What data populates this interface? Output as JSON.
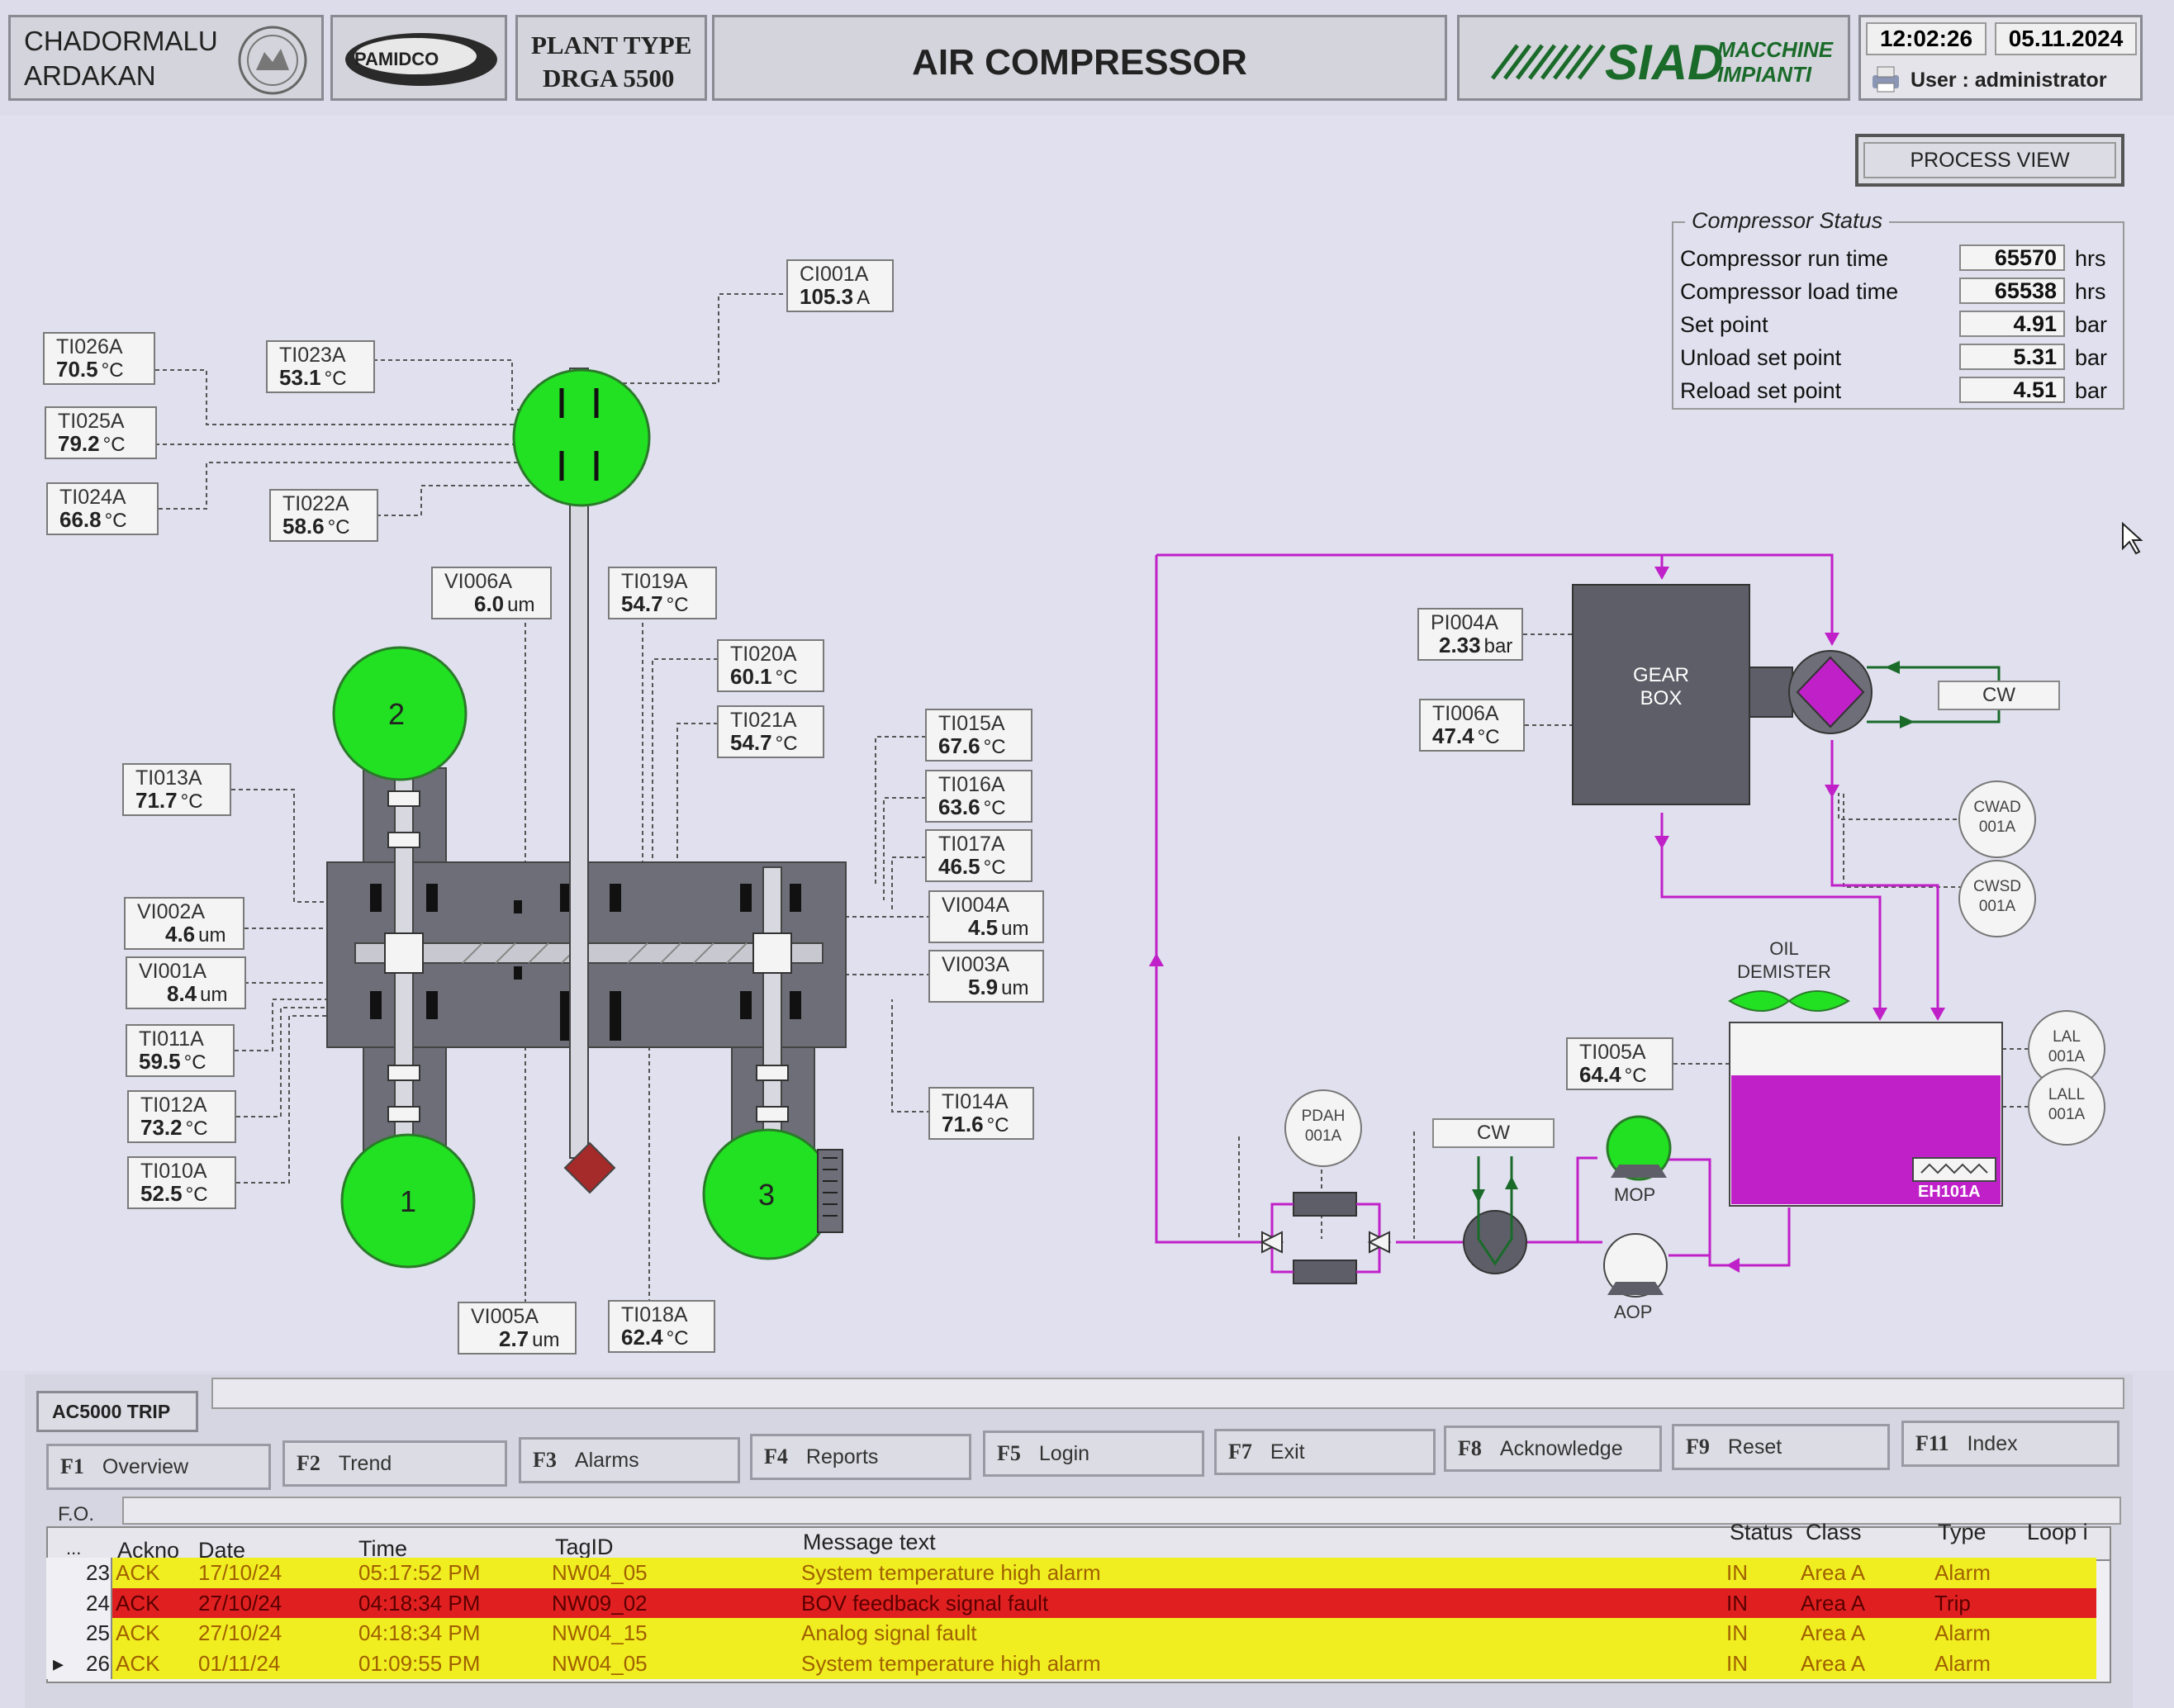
{
  "header": {
    "company_line1": "CHADORMALU",
    "company_line2": "ARDAKAN",
    "brand_logo_text": "PAMIDCO",
    "plant_type_label": "PLANT TYPE",
    "plant_type_value": "DRGA 5500",
    "title": "AIR COMPRESSOR",
    "vendor_logo_main": "SIAD",
    "vendor_logo_sub1": "MACCHINE",
    "vendor_logo_sub2": "IMPIANTI",
    "time": "12:02:26",
    "date": "05.11.2024",
    "user": "User : administrator"
  },
  "process_view_button": "PROCESS VIEW",
  "compressor_status": {
    "title": "Compressor Status",
    "rows": [
      {
        "label": "Compressor run time",
        "value": "65570",
        "unit": "hrs"
      },
      {
        "label": "Compressor load time",
        "value": "65538",
        "unit": "hrs"
      },
      {
        "label": "Set point",
        "value": "4.91",
        "unit": "bar"
      },
      {
        "label": "Unload set point",
        "value": "5.31",
        "unit": "bar"
      },
      {
        "label": "Reload set point",
        "value": "4.51",
        "unit": "bar"
      }
    ]
  },
  "tags": {
    "CI001A": {
      "id": "CI001A",
      "value": "105.3",
      "unit": "A"
    },
    "TI026A": {
      "id": "TI026A",
      "value": "70.5",
      "unit": "°C"
    },
    "TI023A": {
      "id": "TI023A",
      "value": "53.1",
      "unit": "°C"
    },
    "TI025A": {
      "id": "TI025A",
      "value": "79.2",
      "unit": "°C"
    },
    "TI024A": {
      "id": "TI024A",
      "value": "66.8",
      "unit": "°C"
    },
    "TI022A": {
      "id": "TI022A",
      "value": "58.6",
      "unit": "°C"
    },
    "VI006A": {
      "id": "VI006A",
      "value": "6.0",
      "unit": "um"
    },
    "TI019A": {
      "id": "TI019A",
      "value": "54.7",
      "unit": "°C"
    },
    "TI020A": {
      "id": "TI020A",
      "value": "60.1",
      "unit": "°C"
    },
    "TI021A": {
      "id": "TI021A",
      "value": "54.7",
      "unit": "°C"
    },
    "TI015A": {
      "id": "TI015A",
      "value": "67.6",
      "unit": "°C"
    },
    "TI016A": {
      "id": "TI016A",
      "value": "63.6",
      "unit": "°C"
    },
    "TI017A": {
      "id": "TI017A",
      "value": "46.5",
      "unit": "°C"
    },
    "VI004A": {
      "id": "VI004A",
      "value": "4.5",
      "unit": "um"
    },
    "VI003A": {
      "id": "VI003A",
      "value": "5.9",
      "unit": "um"
    },
    "TI014A": {
      "id": "TI014A",
      "value": "71.6",
      "unit": "°C"
    },
    "TI013A": {
      "id": "TI013A",
      "value": "71.7",
      "unit": "°C"
    },
    "VI002A": {
      "id": "VI002A",
      "value": "4.6",
      "unit": "um"
    },
    "VI001A": {
      "id": "VI001A",
      "value": "8.4",
      "unit": "um"
    },
    "TI011A": {
      "id": "TI011A",
      "value": "59.5",
      "unit": "°C"
    },
    "TI012A": {
      "id": "TI012A",
      "value": "73.2",
      "unit": "°C"
    },
    "TI010A": {
      "id": "TI010A",
      "value": "52.5",
      "unit": "°C"
    },
    "VI005A": {
      "id": "VI005A",
      "value": "2.7",
      "unit": "um"
    },
    "TI018A": {
      "id": "TI018A",
      "value": "62.4",
      "unit": "°C"
    },
    "PI004A": {
      "id": "PI004A",
      "value": "2.33",
      "unit": "bar"
    },
    "TI006A": {
      "id": "TI006A",
      "value": "47.4",
      "unit": "°C"
    },
    "TI005A": {
      "id": "TI005A",
      "value": "64.4",
      "unit": "°C"
    }
  },
  "stages": {
    "s1": "1",
    "s2": "2",
    "s3": "3"
  },
  "oil_system": {
    "gearbox_line1": "GEAR",
    "gearbox_line2": "BOX",
    "cw_cooler": "CW",
    "cw_pump": "CW",
    "cwad": [
      "CWAD",
      "001A"
    ],
    "cwsd": [
      "CWSD",
      "001A"
    ],
    "demister_line1": "OIL",
    "demister_line2": "DEMISTER",
    "tank_heater": "EH101A",
    "lal": [
      "LAL",
      "001A"
    ],
    "lall": [
      "LALL",
      "001A"
    ],
    "pdah": [
      "PDAH",
      "001A"
    ],
    "mop": "MOP",
    "aop": "AOP"
  },
  "colors": {
    "running_green": "#22e022",
    "oil_magenta": "#c020c8",
    "alarm_yellow": "#f0ee20",
    "trip_red": "#e02020"
  },
  "trip_label": "AC5000 TRIP",
  "function_keys": [
    {
      "key": "F1",
      "label": "Overview"
    },
    {
      "key": "F2",
      "label": "Trend"
    },
    {
      "key": "F3",
      "label": "Alarms"
    },
    {
      "key": "F4",
      "label": "Reports"
    },
    {
      "key": "F5",
      "label": "Login"
    },
    {
      "key": "F7",
      "label": "Exit"
    },
    {
      "key": "F8",
      "label": "Acknowledge"
    },
    {
      "key": "F9",
      "label": "Reset"
    },
    {
      "key": "F11",
      "label": "Index"
    }
  ],
  "fo_label": "F.O.",
  "alarm_table": {
    "columns": [
      "...",
      "Ackno",
      "Date",
      "Time",
      "TagID",
      "Message text",
      "Status",
      "Class",
      "Type",
      "Loop i"
    ],
    "rows": [
      {
        "num": "23",
        "ack": "ACK",
        "date": "17/10/24",
        "time": "05:17:52 PM",
        "tag": "NW04_05",
        "msg": "System temperature high alarm",
        "status": "IN",
        "class": "Area A",
        "type": "Alarm",
        "color": "#f0ee20"
      },
      {
        "num": "24",
        "ack": "ACK",
        "date": "27/10/24",
        "time": "04:18:34 PM",
        "tag": "NW09_02",
        "msg": "BOV feedback signal fault",
        "status": "IN",
        "class": "Area A",
        "type": "Trip",
        "color": "#e02020"
      },
      {
        "num": "25",
        "ack": "ACK",
        "date": "27/10/24",
        "time": "04:18:34 PM",
        "tag": "NW04_15",
        "msg": "Analog signal fault",
        "status": "IN",
        "class": "Area A",
        "type": "Alarm",
        "color": "#f0ee20"
      },
      {
        "num": "26",
        "ack": "ACK",
        "date": "01/11/24",
        "time": "01:09:55 PM",
        "tag": "NW04_05",
        "msg": "System temperature high alarm",
        "status": "IN",
        "class": "Area A",
        "type": "Alarm",
        "color": "#f0ee20"
      }
    ],
    "row_marker": "▸"
  }
}
